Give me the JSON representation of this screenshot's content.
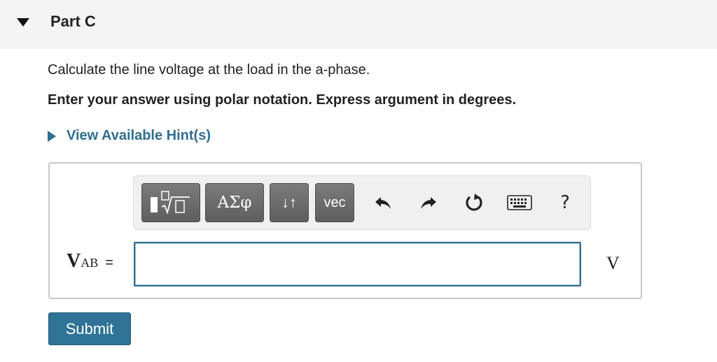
{
  "part": {
    "title": "Part C"
  },
  "question": {
    "text": "Calculate the line voltage at the load in the a-phase.",
    "instruction": "Enter your answer using polar notation. Express argument in degrees."
  },
  "hint": {
    "label": "View Available Hint(s)"
  },
  "toolbar": {
    "greek_label": "ΑΣφ",
    "arrows_label": "↓↑",
    "vec_label": "vec",
    "help_label": "?",
    "icons": [
      "templates-icon",
      "undo-icon",
      "redo-icon",
      "reset-icon",
      "keyboard-icon",
      "help-icon"
    ]
  },
  "answer": {
    "variable": "V",
    "subscript": "AB",
    "equals": "=",
    "value": "",
    "unit": "V"
  },
  "submit": {
    "label": "Submit"
  },
  "colors": {
    "link": "#2f6f8f",
    "submit_bg": "#2f7396",
    "input_border": "#2f6f8f"
  }
}
